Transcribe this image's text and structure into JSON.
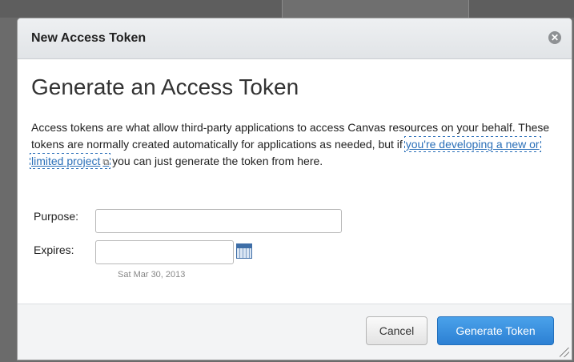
{
  "dialog": {
    "title": "New Access Token",
    "close_icon": "close-icon"
  },
  "content": {
    "heading": "Generate an Access Token",
    "description_before_link": "Access tokens are what allow third-party applications to access Canvas resources on your behalf. These tokens are normally created automatically for applications as needed, but if ",
    "link_text": "you're developing a new or limited project",
    "external_link_icon": "external-link-icon",
    "description_after_link": " you can just generate the token from here."
  },
  "form": {
    "purpose_label": "Purpose:",
    "purpose_value": "",
    "expires_label": "Expires:",
    "expires_value": "",
    "calendar_icon": "calendar-icon",
    "date_hint": "Sat Mar 30, 2013"
  },
  "footer": {
    "cancel_label": "Cancel",
    "generate_label": "Generate Token"
  },
  "colors": {
    "primary_button": "#2c80d3",
    "link": "#2a6fb8"
  }
}
